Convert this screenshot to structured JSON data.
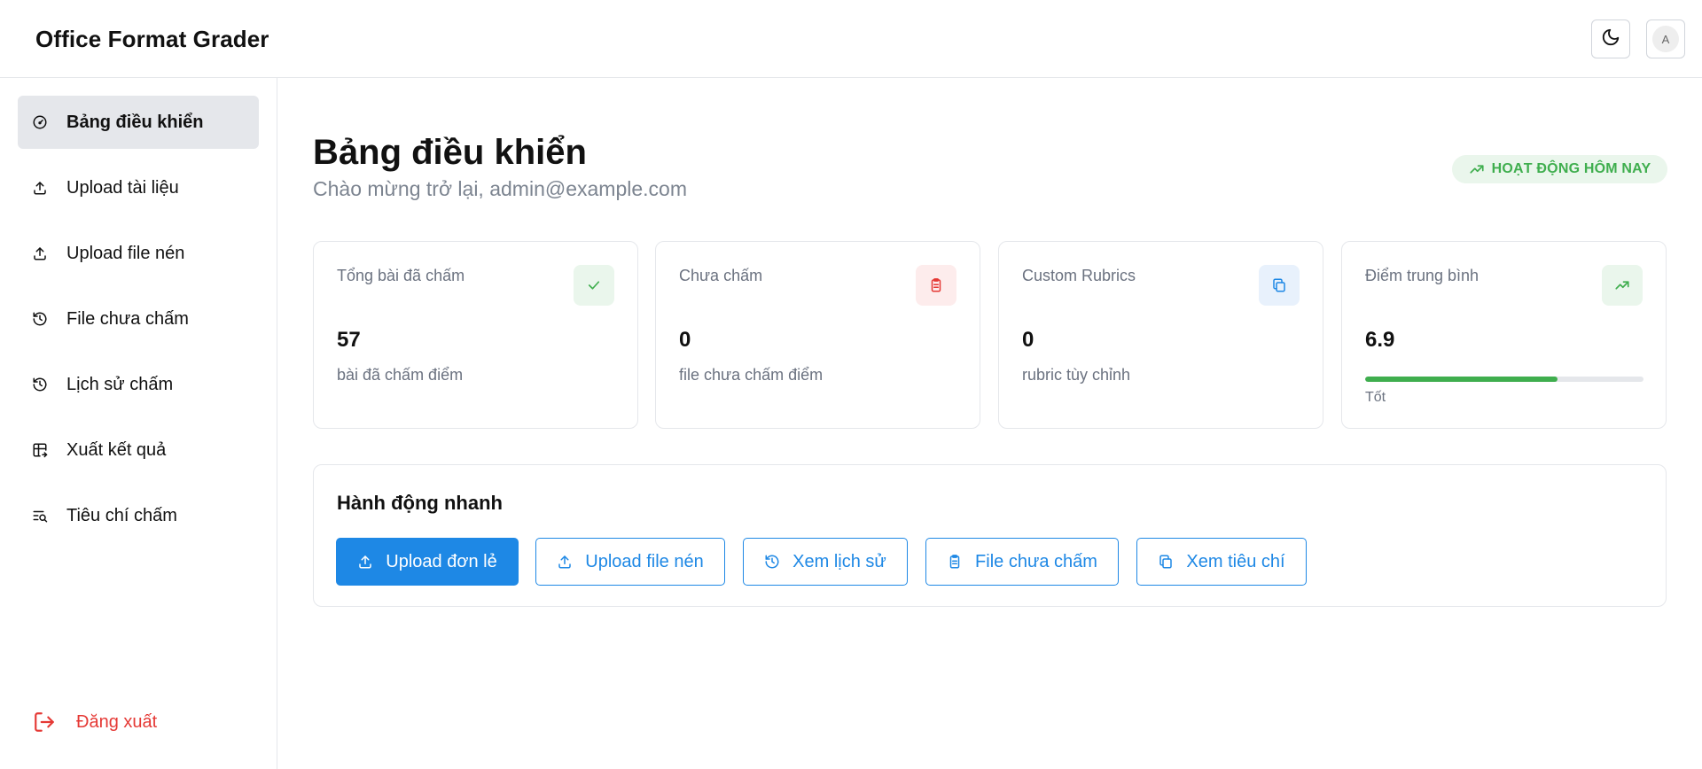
{
  "header": {
    "app_title": "Office Format Grader",
    "theme_toggle_icon": "moon-icon",
    "avatar_initial": "A"
  },
  "sidebar": {
    "items": [
      {
        "label": "Bảng điều khiển",
        "icon": "dashboard-gauge-icon",
        "active": true
      },
      {
        "label": "Upload tài liệu",
        "icon": "upload-icon",
        "active": false
      },
      {
        "label": "Upload file nén",
        "icon": "upload-icon",
        "active": false
      },
      {
        "label": "File chưa chấm",
        "icon": "history-icon",
        "active": false
      },
      {
        "label": "Lịch sử chấm",
        "icon": "history-icon",
        "active": false
      },
      {
        "label": "Xuất kết quả",
        "icon": "table-export-icon",
        "active": false
      },
      {
        "label": "Tiêu chí chấm",
        "icon": "list-search-icon",
        "active": false
      }
    ],
    "logout_label": "Đăng xuất"
  },
  "main": {
    "title": "Bảng điều khiển",
    "subtitle": "Chào mừng trở lại, admin@example.com",
    "activity_badge": "HOẠT ĐỘNG HÔM NAY",
    "stats": [
      {
        "label": "Tổng bài đã chấm",
        "value": "57",
        "description": "bài đã chấm điểm",
        "icon": "check-icon",
        "accent": "#3fae4e",
        "icon_bg": "#eaf6ec"
      },
      {
        "label": "Chưa chấm",
        "value": "0",
        "description": "file chưa chấm điểm",
        "icon": "clipboard-icon",
        "accent": "#e53935",
        "icon_bg": "#fdecec"
      },
      {
        "label": "Custom Rubrics",
        "value": "0",
        "description": "rubric tùy chỉnh",
        "icon": "copy-icon",
        "accent": "#1e88e5",
        "icon_bg": "#e8f1fc"
      },
      {
        "label": "Điểm trung bình",
        "value": "6.9",
        "progress": 0.69,
        "progress_caption": "Tốt",
        "icon": "trending-up-icon",
        "accent": "#3fae4e",
        "icon_bg": "#eaf6ec"
      }
    ],
    "quick_actions": {
      "title": "Hành động nhanh",
      "buttons": [
        {
          "label": "Upload đơn lẻ",
          "icon": "upload-icon",
          "primary": true
        },
        {
          "label": "Upload file nén",
          "icon": "upload-icon",
          "primary": false
        },
        {
          "label": "Xem lịch sử",
          "icon": "history-icon",
          "primary": false
        },
        {
          "label": "File chưa chấm",
          "icon": "clipboard-icon",
          "primary": false
        },
        {
          "label": "Xem tiêu chí",
          "icon": "copy-icon",
          "primary": false
        }
      ]
    }
  },
  "colors": {
    "primary": "#1e88e5",
    "success": "#3fae4e",
    "danger": "#e53935",
    "active_nav_bg": "#e5e7eb"
  }
}
